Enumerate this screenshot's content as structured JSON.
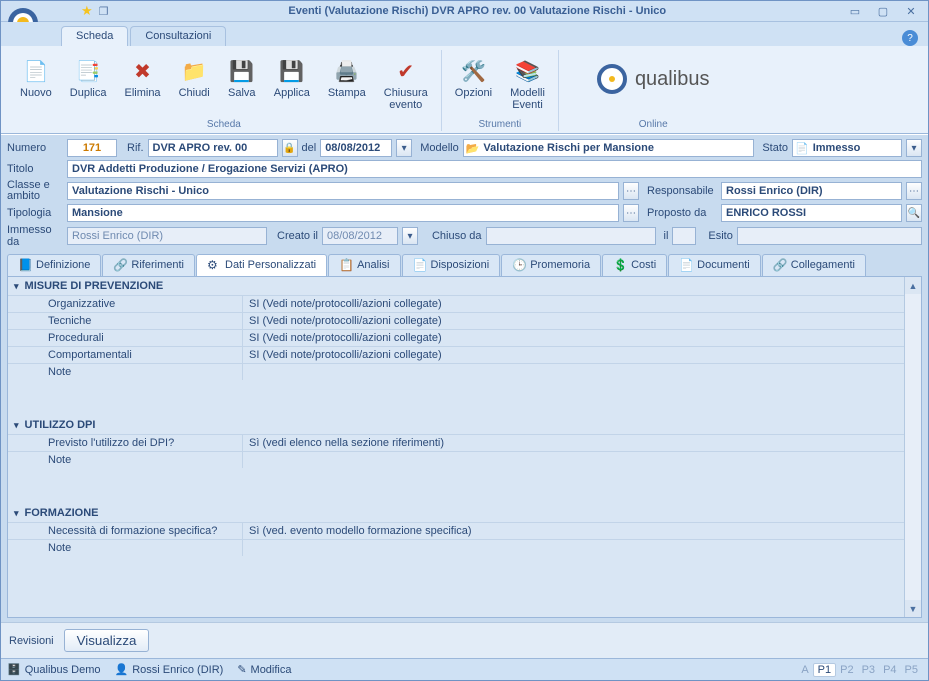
{
  "window": {
    "title": "Eventi (Valutazione Rischi)  DVR APRO rev. 00 Valutazione Rischi - Unico"
  },
  "ribbon_tabs": {
    "scheda": "Scheda",
    "consultazioni": "Consultazioni"
  },
  "ribbon": {
    "nuovo": {
      "label": "Nuovo"
    },
    "duplica": {
      "label": "Duplica"
    },
    "elimina": {
      "label": "Elimina"
    },
    "chiudi": {
      "label": "Chiudi"
    },
    "salva": {
      "label": "Salva"
    },
    "applica": {
      "label": "Applica"
    },
    "stampa": {
      "label": "Stampa"
    },
    "chiusura": {
      "label": "Chiusura\nevento"
    },
    "opzioni": {
      "label": "Opzioni"
    },
    "modelli": {
      "label": "Modelli\nEventi"
    },
    "group_scheda": "Scheda",
    "group_strumenti": "Strumenti",
    "group_online": "Online",
    "brand": "qualibus"
  },
  "form": {
    "numero_label": "Numero",
    "numero": "171",
    "rif_label": "Rif.",
    "rif": "DVR APRO rev. 00",
    "del_label": "del",
    "del": "08/08/2012",
    "modello_label": "Modello",
    "modello": "Valutazione Rischi per Mansione",
    "stato_label": "Stato",
    "stato": "Immesso",
    "titolo_label": "Titolo",
    "titolo": "DVR Addetti Produzione / Erogazione Servizi (APRO)",
    "classe_label": "Classe e ambito",
    "classe": "Valutazione Rischi - Unico",
    "responsabile_label": "Responsabile",
    "responsabile": "Rossi Enrico (DIR)",
    "tipologia_label": "Tipologia",
    "tipologia": "Mansione",
    "proposto_label": "Proposto da",
    "proposto": "ENRICO ROSSI",
    "immesso_label": "Immesso da",
    "immesso": "Rossi Enrico (DIR)",
    "creato_label": "Creato il",
    "creato": "08/08/2012",
    "chiuso_label": "Chiuso da",
    "chiuso": "",
    "il_label": "il",
    "il": "",
    "esito_label": "Esito",
    "esito": ""
  },
  "itabs": {
    "definizione": "Definizione",
    "riferimenti": "Riferimenti",
    "dati": "Dati Personalizzati",
    "analisi": "Analisi",
    "disposizioni": "Disposizioni",
    "promemoria": "Promemoria",
    "costi": "Costi",
    "documenti": "Documenti",
    "collegamenti": "Collegamenti"
  },
  "sections": [
    {
      "title": "MISURE DI PREVENZIONE",
      "rows": [
        {
          "k": "Organizzative",
          "v": "SI (Vedi note/protocolli/azioni collegate)"
        },
        {
          "k": "Tecniche",
          "v": "SI (Vedi note/protocolli/azioni collegate)"
        },
        {
          "k": "Procedurali",
          "v": "SI (Vedi note/protocolli/azioni collegate)"
        },
        {
          "k": "Comportamentali",
          "v": "SI (Vedi note/protocolli/azioni collegate)"
        },
        {
          "k": "Note",
          "v": ""
        }
      ]
    },
    {
      "title": "UTILIZZO DPI",
      "rows": [
        {
          "k": "Previsto l'utilizzo dei DPI?",
          "v": "Sì (vedi elenco nella sezione riferimenti)"
        },
        {
          "k": "Note",
          "v": ""
        }
      ]
    },
    {
      "title": "FORMAZIONE",
      "rows": [
        {
          "k": "Necessità di formazione specifica?",
          "v": "Sì (ved. evento modello formazione specifica)"
        },
        {
          "k": "Note",
          "v": ""
        }
      ]
    }
  ],
  "revisioni": {
    "label": "Revisioni",
    "visualizza": "Visualizza"
  },
  "status": {
    "db": "Qualibus Demo",
    "user": "Rossi Enrico (DIR)",
    "mode": "Modifica",
    "pages": [
      "A",
      "P1",
      "P2",
      "P3",
      "P4",
      "P5"
    ]
  }
}
